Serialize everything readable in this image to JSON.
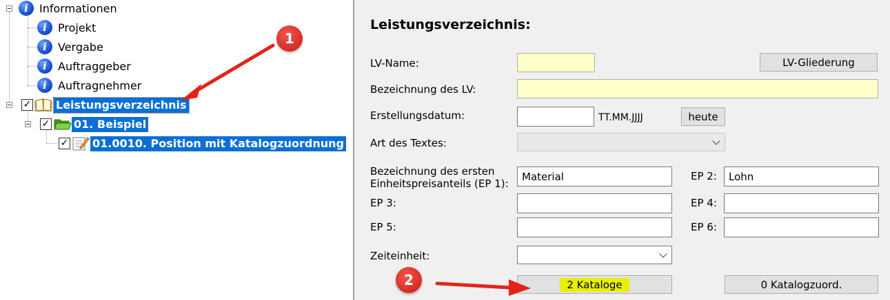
{
  "tree": {
    "root": {
      "label": "Informationen",
      "icon": "info-icon"
    },
    "info_children": [
      {
        "label": "Projekt"
      },
      {
        "label": "Vergabe"
      },
      {
        "label": "Auftraggeber"
      },
      {
        "label": "Auftragnehmer"
      }
    ],
    "lv": {
      "label": "Leistungsverzeichnis",
      "checked": true,
      "icon": "book-icon"
    },
    "group": {
      "label": "01. Beispiel",
      "checked": true,
      "icon": "folder-icon"
    },
    "position": {
      "label": "01.0010. Position mit Katalogzuordnung",
      "checked": true,
      "icon": "edit-document-icon"
    }
  },
  "form": {
    "title": "Leistungsverzeichnis:",
    "lv_name_label": "LV-Name:",
    "lv_name_value": "",
    "lv_gliederung_button": "LV-Gliederung",
    "bezeichnung_label": "Bezeichnung des LV:",
    "bezeichnung_value": "",
    "erstellungsdatum_label": "Erstellungsdatum:",
    "erstellungsdatum_value": "",
    "date_format": "TT.MM.JJJJ",
    "heute_button": "heute",
    "art_label": "Art des Textes:",
    "art_value": "",
    "ep1_label_line1": "Bezeichnung des ersten",
    "ep1_label_line2": "Einheitspreisanteils (EP 1):",
    "ep1_value": "Material",
    "ep2_label": "EP 2:",
    "ep2_value": "Lohn",
    "ep3_label": "EP 3:",
    "ep3_value": "",
    "ep4_label": "EP 4:",
    "ep4_value": "",
    "ep5_label": "EP 5:",
    "ep5_value": "",
    "ep6_label": "EP 6:",
    "ep6_value": "",
    "zeiteinheit_label": "Zeiteinheit:",
    "zeiteinheit_value": "",
    "kataloge_button": "2 Kataloge",
    "katalogzuord_button": "0 Katalogzuord."
  },
  "annotations": {
    "badge1": "1",
    "badge2": "2",
    "color": "#d62c23",
    "highlight": "#e8f00a"
  },
  "colors": {
    "selection": "#0a6fd6",
    "panel_bg": "#f0f0f0",
    "required_field": "#ffffcc"
  }
}
